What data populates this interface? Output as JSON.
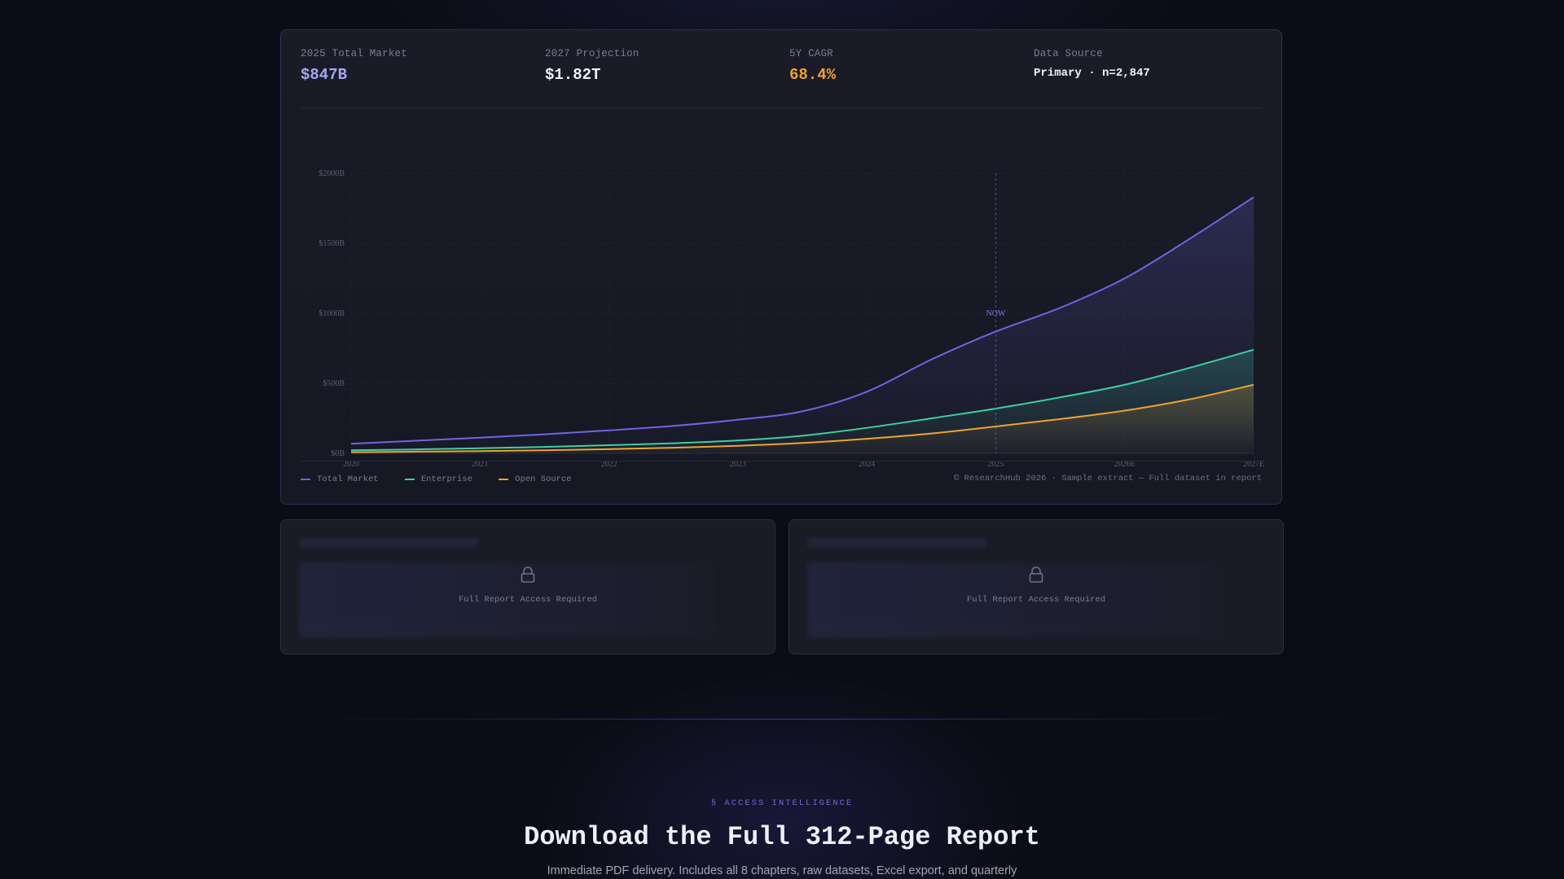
{
  "stats": [
    {
      "label": "2025 Total Market",
      "value": "$847B",
      "color": "#a5a8f5"
    },
    {
      "label": "2027 Projection",
      "value": "$1.82T",
      "color": "#f1f2f7"
    },
    {
      "label": "5Y CAGR",
      "value": "68.4%",
      "color": "#f0a230"
    },
    {
      "label": "Data Source",
      "value": "Primary · n=2,847",
      "color": "#f1f2f7"
    }
  ],
  "chart_data": {
    "type": "area",
    "categories": [
      "2020",
      "2021",
      "2022",
      "2023",
      "2024",
      "2025",
      "2026E",
      "2027E"
    ],
    "x": [
      2020,
      2020.5,
      2021,
      2021.5,
      2022,
      2022.5,
      2023,
      2023.5,
      2024,
      2024.5,
      2025,
      2025.5,
      2026,
      2026.5,
      2027
    ],
    "ylim": [
      0,
      2000
    ],
    "y_ticks": [
      "$0B",
      "$500B",
      "$1000B",
      "$1500B",
      "$2000B"
    ],
    "y_tick_values": [
      0,
      500,
      1000,
      1500,
      2000
    ],
    "now_label": "NOW",
    "now_x": 2025,
    "grid": true,
    "series": [
      {
        "name": "Total Market",
        "color": "#6c66e0",
        "values": [
          68,
          90,
          112,
          136,
          164,
          196,
          240,
          300,
          440,
          670,
          870,
          1040,
          1250,
          1530,
          1830
        ]
      },
      {
        "name": "Enterprise",
        "color": "#3fcfa0",
        "values": [
          22,
          28,
          36,
          46,
          58,
          72,
          92,
          126,
          182,
          250,
          320,
          400,
          490,
          610,
          740
        ]
      },
      {
        "name": "Open Source",
        "color": "#f0a230",
        "values": [
          8,
          12,
          16,
          22,
          30,
          40,
          54,
          74,
          104,
          142,
          192,
          245,
          305,
          385,
          490
        ]
      }
    ]
  },
  "legend": [
    {
      "label": "Total Market",
      "color": "#6c66e0"
    },
    {
      "label": "Enterprise",
      "color": "#3fcfa0"
    },
    {
      "label": "Open Source",
      "color": "#f0a230"
    }
  ],
  "copyright": "© ResearchHub 2026 · Sample extract — Full dataset in report",
  "locked_panels": [
    {
      "text": "Full Report Access Required"
    },
    {
      "text": "Full Report Access Required"
    }
  ],
  "cta": {
    "kicker": "§ ACCESS INTELLIGENCE",
    "title": "Download the Full 312-Page Report",
    "subtitle": "Immediate PDF delivery. Includes all 8 chapters, raw datasets, Excel export, and quarterly"
  }
}
